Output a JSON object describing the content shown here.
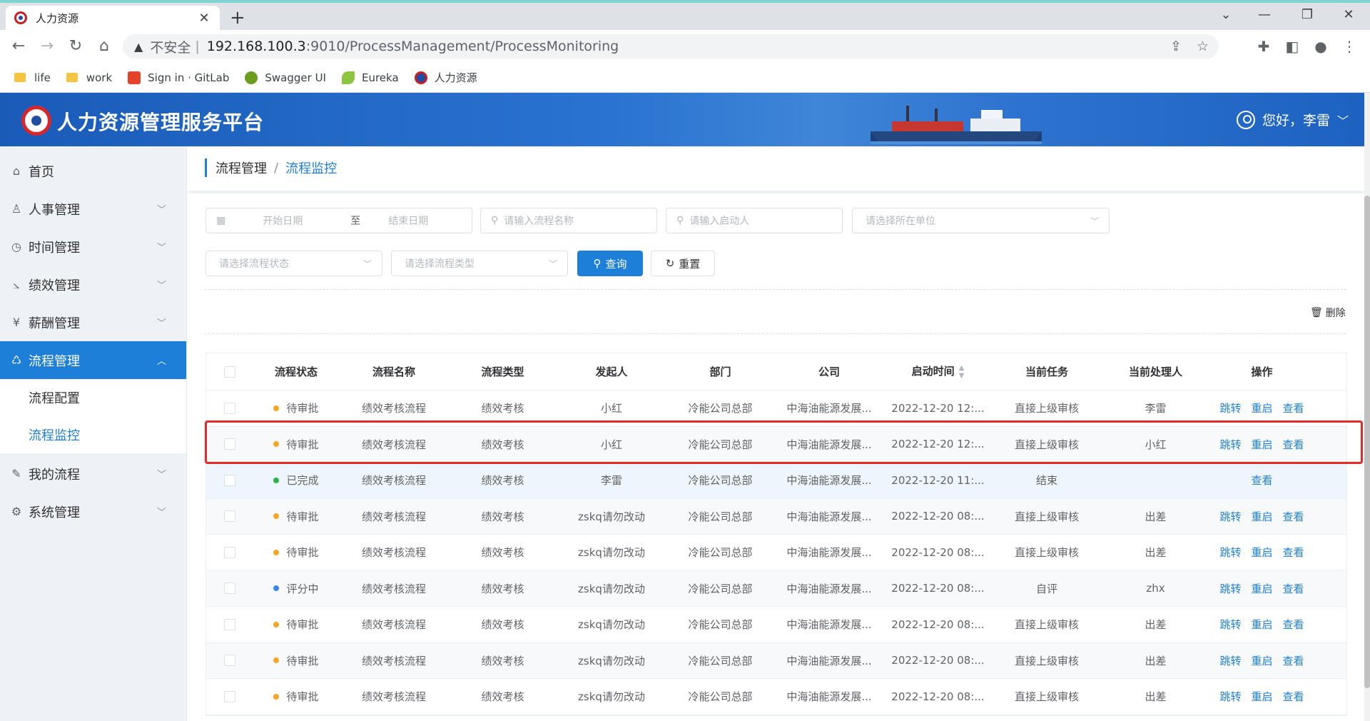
{
  "browser": {
    "tab_title": "人力资源",
    "tab_close": "✕",
    "new_tab": "+",
    "insecure_label": "不安全",
    "separator": "|",
    "url_host": "192.168.100.3",
    "url_path": ":9010/ProcessManagement/ProcessMonitoring",
    "bookmarks": [
      {
        "label": "life",
        "icon": "folder-icon"
      },
      {
        "label": "work",
        "icon": "folder-icon"
      },
      {
        "label": "Sign in · GitLab",
        "icon": "gitlab-icon"
      },
      {
        "label": "Swagger UI",
        "icon": "swagger-icon"
      },
      {
        "label": "Eureka",
        "icon": "eureka-leaf-icon"
      },
      {
        "label": "人力资源",
        "icon": "cnooc-logo-icon"
      }
    ]
  },
  "header": {
    "title": "人力资源管理服务平台",
    "greeting": "您好，李雷"
  },
  "sidebar": {
    "items": [
      {
        "label": "首页",
        "icon": "home-icon"
      },
      {
        "label": "人事管理",
        "icon": "person-icon"
      },
      {
        "label": "时间管理",
        "icon": "clock-icon"
      },
      {
        "label": "绩效管理",
        "icon": "chart-icon"
      },
      {
        "label": "薪酬管理",
        "icon": "yen-icon"
      },
      {
        "label": "流程管理",
        "icon": "process-icon"
      },
      {
        "label": "我的流程",
        "icon": "edit-list-icon"
      },
      {
        "label": "系统管理",
        "icon": "gear-icon"
      }
    ],
    "sub_items": [
      {
        "label": "流程配置"
      },
      {
        "label": "流程监控"
      }
    ]
  },
  "breadcrumb": {
    "parent": "流程管理",
    "separator": "/",
    "current": "流程监控"
  },
  "filters": {
    "start_date_placeholder": "开始日期",
    "range_separator": "至",
    "end_date_placeholder": "结束日期",
    "process_name_placeholder": "请输入流程名称",
    "initiator_placeholder": "请输入启动人",
    "unit_placeholder": "请选择所在单位",
    "status_placeholder": "请选择流程状态",
    "type_placeholder": "请选择流程类型",
    "query_label": "查询",
    "reset_label": "重置"
  },
  "toolbar": {
    "delete_label": "删除"
  },
  "table": {
    "headers": {
      "status": "流程状态",
      "name": "流程名称",
      "type": "流程类型",
      "initiator": "发起人",
      "department": "部门",
      "company": "公司",
      "start_time": "启动时间",
      "current_task": "当前任务",
      "handler": "当前处理人",
      "ops": "操作"
    },
    "op_labels": {
      "transfer": "跳转",
      "restart": "重启",
      "view": "查看"
    },
    "status_colors": {
      "pending": "#f5a623",
      "done": "#2bb44a",
      "scoring": "#3a86e8"
    },
    "rows": [
      {
        "status": "待审批",
        "status_key": "pending",
        "name": "绩效考核流程",
        "type": "绩效考核",
        "initiator": "小红",
        "department": "冷能公司总部",
        "company": "中海油能源发展...",
        "start_time": "2022-12-20 12:...",
        "current_task": "直接上级审核",
        "handler": "李雷",
        "ops": [
          "transfer",
          "restart",
          "view"
        ]
      },
      {
        "status": "待审批",
        "status_key": "pending",
        "name": "绩效考核流程",
        "type": "绩效考核",
        "initiator": "小红",
        "department": "冷能公司总部",
        "company": "中海油能源发展...",
        "start_time": "2022-12-20 12:...",
        "current_task": "直接上级审核",
        "handler": "小红",
        "ops": [
          "transfer",
          "restart",
          "view"
        ]
      },
      {
        "status": "已完成",
        "status_key": "done",
        "name": "绩效考核流程",
        "type": "绩效考核",
        "initiator": "李雷",
        "department": "冷能公司总部",
        "company": "中海油能源发展...",
        "start_time": "2022-12-20 11:...",
        "current_task": "结束",
        "handler": "",
        "ops": [
          "view"
        ]
      },
      {
        "status": "待审批",
        "status_key": "pending",
        "name": "绩效考核流程",
        "type": "绩效考核",
        "initiator": "zskq请勿改动",
        "department": "冷能公司总部",
        "company": "中海油能源发展...",
        "start_time": "2022-12-20 08:...",
        "current_task": "直接上级审核",
        "handler": "出差",
        "ops": [
          "transfer",
          "restart",
          "view"
        ]
      },
      {
        "status": "待审批",
        "status_key": "pending",
        "name": "绩效考核流程",
        "type": "绩效考核",
        "initiator": "zskq请勿改动",
        "department": "冷能公司总部",
        "company": "中海油能源发展...",
        "start_time": "2022-12-20 08:...",
        "current_task": "直接上级审核",
        "handler": "出差",
        "ops": [
          "transfer",
          "restart",
          "view"
        ]
      },
      {
        "status": "评分中",
        "status_key": "scoring",
        "name": "绩效考核流程",
        "type": "绩效考核",
        "initiator": "zskq请勿改动",
        "department": "冷能公司总部",
        "company": "中海油能源发展...",
        "start_time": "2022-12-20 08:...",
        "current_task": "自评",
        "handler": "zhx",
        "ops": [
          "transfer",
          "restart",
          "view"
        ]
      },
      {
        "status": "待审批",
        "status_key": "pending",
        "name": "绩效考核流程",
        "type": "绩效考核",
        "initiator": "zskq请勿改动",
        "department": "冷能公司总部",
        "company": "中海油能源发展...",
        "start_time": "2022-12-20 08:...",
        "current_task": "直接上级审核",
        "handler": "出差",
        "ops": [
          "transfer",
          "restart",
          "view"
        ]
      },
      {
        "status": "待审批",
        "status_key": "pending",
        "name": "绩效考核流程",
        "type": "绩效考核",
        "initiator": "zskq请勿改动",
        "department": "冷能公司总部",
        "company": "中海油能源发展...",
        "start_time": "2022-12-20 08:...",
        "current_task": "直接上级审核",
        "handler": "出差",
        "ops": [
          "transfer",
          "restart",
          "view"
        ]
      },
      {
        "status": "待审批",
        "status_key": "pending",
        "name": "绩效考核流程",
        "type": "绩效考核",
        "initiator": "zskq请勿改动",
        "department": "冷能公司总部",
        "company": "中海油能源发展...",
        "start_time": "2022-12-20 08:...",
        "current_task": "直接上级审核",
        "handler": "出差",
        "ops": [
          "transfer",
          "restart",
          "view"
        ]
      }
    ]
  }
}
